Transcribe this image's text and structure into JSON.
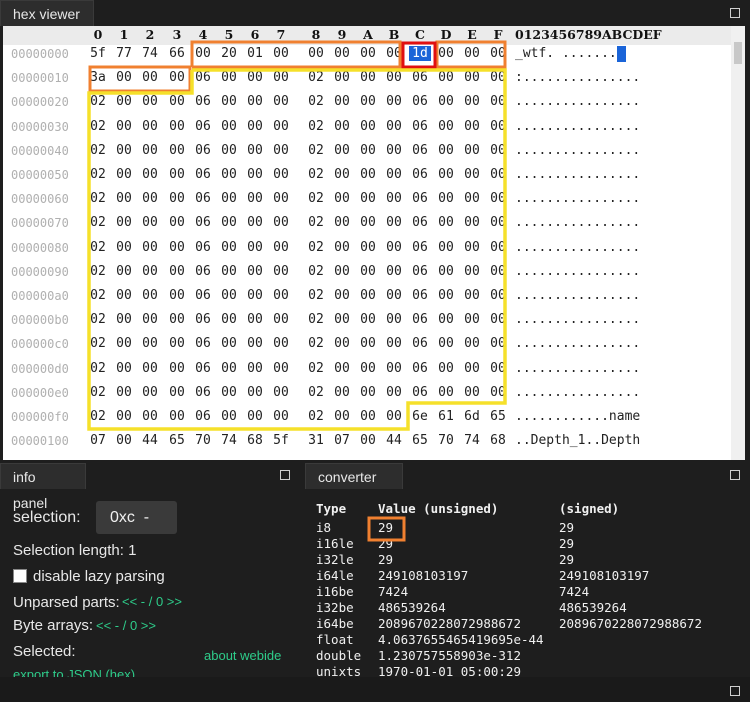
{
  "hex_viewer": {
    "tab_label": "hex viewer",
    "column_headers": [
      "0",
      "1",
      "2",
      "3",
      "4",
      "5",
      "6",
      "7",
      "8",
      "9",
      "A",
      "B",
      "C",
      "D",
      "E",
      "F"
    ],
    "ascii_header": "0123456789ABCDEF",
    "rows": [
      {
        "addr": "00000000",
        "bytes": [
          "5f",
          "77",
          "74",
          "66",
          "00",
          "20",
          "01",
          "00",
          "00",
          "00",
          "00",
          "00",
          "1d",
          "00",
          "00",
          "00"
        ],
        "ascii": "_wtf. ......."
      },
      {
        "addr": "00000010",
        "bytes": [
          "3a",
          "00",
          "00",
          "00",
          "06",
          "00",
          "00",
          "00",
          "02",
          "00",
          "00",
          "00",
          "06",
          "00",
          "00",
          "00"
        ],
        "ascii": ":..............."
      },
      {
        "addr": "00000020",
        "bytes": [
          "02",
          "00",
          "00",
          "00",
          "06",
          "00",
          "00",
          "00",
          "02",
          "00",
          "00",
          "00",
          "06",
          "00",
          "00",
          "00"
        ],
        "ascii": "................"
      },
      {
        "addr": "00000030",
        "bytes": [
          "02",
          "00",
          "00",
          "00",
          "06",
          "00",
          "00",
          "00",
          "02",
          "00",
          "00",
          "00",
          "06",
          "00",
          "00",
          "00"
        ],
        "ascii": "................"
      },
      {
        "addr": "00000040",
        "bytes": [
          "02",
          "00",
          "00",
          "00",
          "06",
          "00",
          "00",
          "00",
          "02",
          "00",
          "00",
          "00",
          "06",
          "00",
          "00",
          "00"
        ],
        "ascii": "................"
      },
      {
        "addr": "00000050",
        "bytes": [
          "02",
          "00",
          "00",
          "00",
          "06",
          "00",
          "00",
          "00",
          "02",
          "00",
          "00",
          "00",
          "06",
          "00",
          "00",
          "00"
        ],
        "ascii": "................"
      },
      {
        "addr": "00000060",
        "bytes": [
          "02",
          "00",
          "00",
          "00",
          "06",
          "00",
          "00",
          "00",
          "02",
          "00",
          "00",
          "00",
          "06",
          "00",
          "00",
          "00"
        ],
        "ascii": "................"
      },
      {
        "addr": "00000070",
        "bytes": [
          "02",
          "00",
          "00",
          "00",
          "06",
          "00",
          "00",
          "00",
          "02",
          "00",
          "00",
          "00",
          "06",
          "00",
          "00",
          "00"
        ],
        "ascii": "................"
      },
      {
        "addr": "00000080",
        "bytes": [
          "02",
          "00",
          "00",
          "00",
          "06",
          "00",
          "00",
          "00",
          "02",
          "00",
          "00",
          "00",
          "06",
          "00",
          "00",
          "00"
        ],
        "ascii": "................"
      },
      {
        "addr": "00000090",
        "bytes": [
          "02",
          "00",
          "00",
          "00",
          "06",
          "00",
          "00",
          "00",
          "02",
          "00",
          "00",
          "00",
          "06",
          "00",
          "00",
          "00"
        ],
        "ascii": "................"
      },
      {
        "addr": "000000a0",
        "bytes": [
          "02",
          "00",
          "00",
          "00",
          "06",
          "00",
          "00",
          "00",
          "02",
          "00",
          "00",
          "00",
          "06",
          "00",
          "00",
          "00"
        ],
        "ascii": "................"
      },
      {
        "addr": "000000b0",
        "bytes": [
          "02",
          "00",
          "00",
          "00",
          "06",
          "00",
          "00",
          "00",
          "02",
          "00",
          "00",
          "00",
          "06",
          "00",
          "00",
          "00"
        ],
        "ascii": "................"
      },
      {
        "addr": "000000c0",
        "bytes": [
          "02",
          "00",
          "00",
          "00",
          "06",
          "00",
          "00",
          "00",
          "02",
          "00",
          "00",
          "00",
          "06",
          "00",
          "00",
          "00"
        ],
        "ascii": "................"
      },
      {
        "addr": "000000d0",
        "bytes": [
          "02",
          "00",
          "00",
          "00",
          "06",
          "00",
          "00",
          "00",
          "02",
          "00",
          "00",
          "00",
          "06",
          "00",
          "00",
          "00"
        ],
        "ascii": "................"
      },
      {
        "addr": "000000e0",
        "bytes": [
          "02",
          "00",
          "00",
          "00",
          "06",
          "00",
          "00",
          "00",
          "02",
          "00",
          "00",
          "00",
          "06",
          "00",
          "00",
          "00"
        ],
        "ascii": "................"
      },
      {
        "addr": "000000f0",
        "bytes": [
          "02",
          "00",
          "00",
          "00",
          "06",
          "00",
          "00",
          "00",
          "02",
          "00",
          "00",
          "00",
          "6e",
          "61",
          "6d",
          "65"
        ],
        "ascii": "............name"
      },
      {
        "addr": "00000100",
        "bytes": [
          "07",
          "00",
          "44",
          "65",
          "70",
          "74",
          "68",
          "5f",
          "31",
          "07",
          "00",
          "44",
          "65",
          "70",
          "74",
          "68"
        ],
        "ascii": "..Depth_1..Depth"
      }
    ],
    "selected_byte": {
      "row": 0,
      "col": 12
    },
    "colors": {
      "selection": "#1a64d8",
      "orange_highlight": "#f08030",
      "red_highlight": "#e01010",
      "yellow_highlight": "#f5e02a"
    }
  },
  "info_panel": {
    "tab_label": "info panel",
    "selection_label": "selection:",
    "selection_value": "0xc  -",
    "selection_length": "Selection length: 1",
    "disable_lazy_parsing": "disable lazy parsing",
    "unparsed_parts_label": "Unparsed parts:",
    "unparsed_nav": "<< - / 0 >>",
    "byte_arrays_label": "Byte arrays:",
    "byte_arrays_nav": "<< - / 0 >>",
    "selected_label": "Selected:",
    "about_link": "about webide",
    "export_link": "export to JSON (hex)"
  },
  "converter": {
    "tab_label": "converter",
    "headers": {
      "type": "Type",
      "unsigned": "Value (unsigned)",
      "signed": "(signed)"
    },
    "rows": [
      {
        "type": "i8",
        "unsigned": "29",
        "signed": "29"
      },
      {
        "type": "i16le",
        "unsigned": "29",
        "signed": "29"
      },
      {
        "type": "i32le",
        "unsigned": "29",
        "signed": "29"
      },
      {
        "type": "i64le",
        "unsigned": "249108103197",
        "signed": "249108103197"
      },
      {
        "type": "i16be",
        "unsigned": "7424",
        "signed": "7424"
      },
      {
        "type": "i32be",
        "unsigned": "486539264",
        "signed": "486539264"
      },
      {
        "type": "i64be",
        "unsigned": "2089670228072988672",
        "signed": "2089670228072988672"
      },
      {
        "type": "float",
        "unsigned": "4.0637655465419695e-44",
        "signed": ""
      },
      {
        "type": "double",
        "unsigned": "1.230757558903e-312",
        "signed": ""
      },
      {
        "type": "unixts",
        "unsigned": "1970-01-01 05:00:29",
        "signed": ""
      }
    ]
  }
}
